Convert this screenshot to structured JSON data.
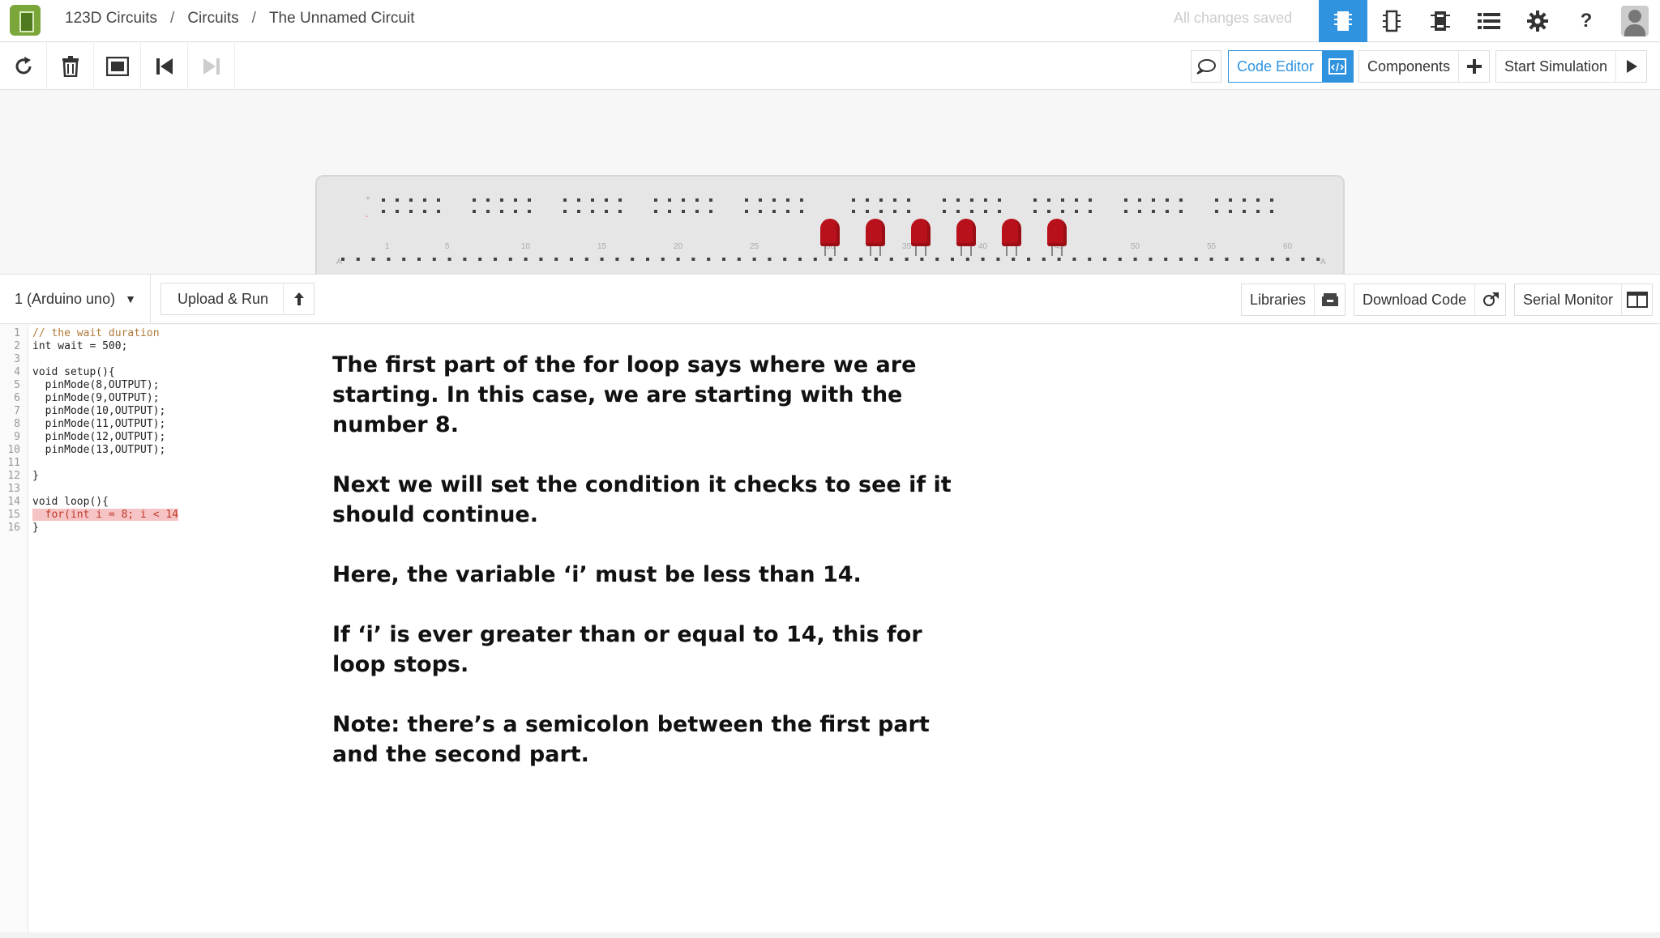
{
  "topbar": {
    "breadcrumb": [
      "123D Circuits",
      "Circuits",
      "The Unnamed Circuit"
    ],
    "separator": "/",
    "save_status": "All changes saved",
    "icons": [
      "breadboard-view-icon",
      "schematic-view-icon",
      "pcb-view-icon",
      "list-icon",
      "gear-icon",
      "help-icon",
      "user-avatar-icon"
    ],
    "help_glyph": "?"
  },
  "toolbar": {
    "left_icons": [
      "rotate-icon",
      "trash-icon",
      "fit-to-screen-icon",
      "step-back-icon",
      "step-forward-icon"
    ],
    "code_editor_label": "Code Editor",
    "components_label": "Components",
    "start_simulation_label": "Start Simulation",
    "accent_color": "#2f93e0"
  },
  "breadboard": {
    "led_color": "#b8111b",
    "led_count": 6,
    "column_labels": [
      "1",
      "5",
      "10",
      "15",
      "20",
      "25",
      "30",
      "35",
      "40",
      "45",
      "50",
      "55",
      "60"
    ],
    "row_labels": [
      "+",
      "-",
      "A",
      "A"
    ]
  },
  "codebar": {
    "board": "1 (Arduino uno)",
    "upload_label": "Upload & Run",
    "libraries_label": "Libraries",
    "download_label": "Download Code",
    "serial_label": "Serial Monitor"
  },
  "editor": {
    "lines": [
      {
        "n": "1",
        "text": "// the wait duration",
        "type": "comment"
      },
      {
        "n": "2",
        "text": "int wait = 500;",
        "type": "code"
      },
      {
        "n": "3",
        "text": "",
        "type": "code"
      },
      {
        "n": "4",
        "text": "void setup(){",
        "type": "code"
      },
      {
        "n": "5",
        "text": "  pinMode(8,OUTPUT);",
        "type": "code"
      },
      {
        "n": "6",
        "text": "  pinMode(9,OUTPUT);",
        "type": "code"
      },
      {
        "n": "7",
        "text": "  pinMode(10,OUTPUT);",
        "type": "code"
      },
      {
        "n": "8",
        "text": "  pinMode(11,OUTPUT);",
        "type": "code"
      },
      {
        "n": "9",
        "text": "  pinMode(12,OUTPUT);",
        "type": "code"
      },
      {
        "n": "10",
        "text": "  pinMode(13,OUTPUT);",
        "type": "code"
      },
      {
        "n": "11",
        "text": "",
        "type": "code"
      },
      {
        "n": "12",
        "text": "}",
        "type": "code"
      },
      {
        "n": "13",
        "text": "",
        "type": "code"
      },
      {
        "n": "14",
        "text": "void loop(){",
        "type": "code"
      },
      {
        "n": "15",
        "text": "  for(int i = 8; i < 14",
        "type": "highlight"
      },
      {
        "n": "16",
        "text": "}",
        "type": "code"
      }
    ]
  },
  "annotation": {
    "paragraphs": [
      "The first part of the for loop says where we are starting. In this case, we are starting with the number 8.",
      "Next we will set the condition it checks to see if it should continue.",
      "Here, the variable ‘i’ must be less than 14.",
      "If ‘i’ is ever greater than or equal to 14, this for loop stops.",
      "Note: there’s a semicolon between the first part and the second part."
    ]
  }
}
